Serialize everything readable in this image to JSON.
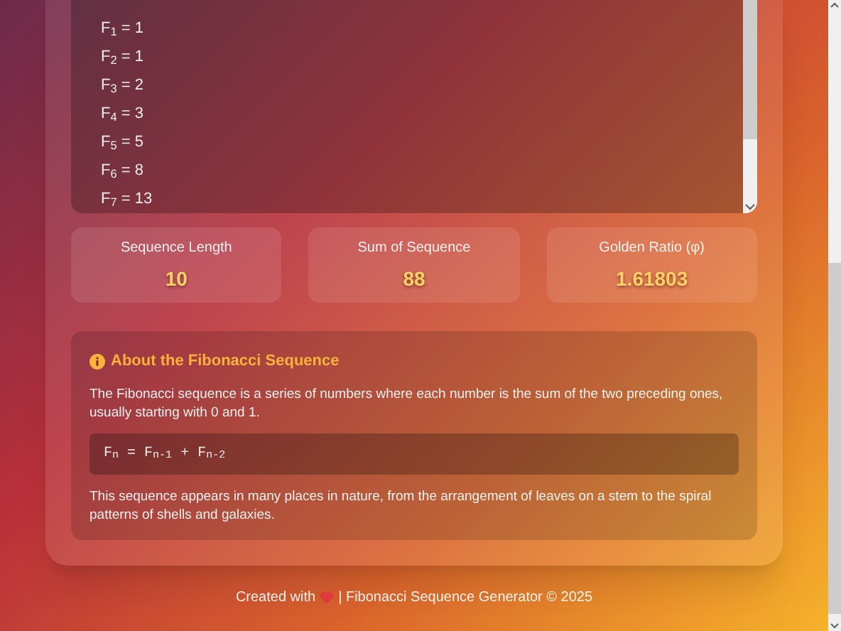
{
  "sequence": [
    {
      "text": "F$_{1}$ = 1"
    },
    {
      "text": "F$_{2}$ = 1"
    },
    {
      "text": "F$_{3}$ = 2"
    },
    {
      "text": "F$_{4}$ = 3"
    },
    {
      "text": "F$_{5}$ = 5"
    },
    {
      "text": "F$_{6}$ = 8"
    },
    {
      "text": "F$_{7}$ = 13"
    }
  ],
  "stats": [
    {
      "label": "Sequence Length",
      "value": "10"
    },
    {
      "label": "Sum of Sequence",
      "value": "88"
    },
    {
      "label": "Golden Ratio (φ)",
      "value": "1.61803"
    }
  ],
  "about": {
    "title": "About the Fibonacci Sequence",
    "intro": "The Fibonacci sequence is a series of numbers where each number is the sum of the two preceding ones, usually starting with 0 and 1.",
    "formula": "F$_{n}$ = F$_{n-1}$ + F$_{n-2}$",
    "outro": "This sequence appears in many places in nature, from the arrangement of leaves on a stem to the spiral patterns of shells and galaxies."
  },
  "footer": {
    "before": "Created with",
    "after": "| Fibonacci Sequence Generator © 2025"
  }
}
